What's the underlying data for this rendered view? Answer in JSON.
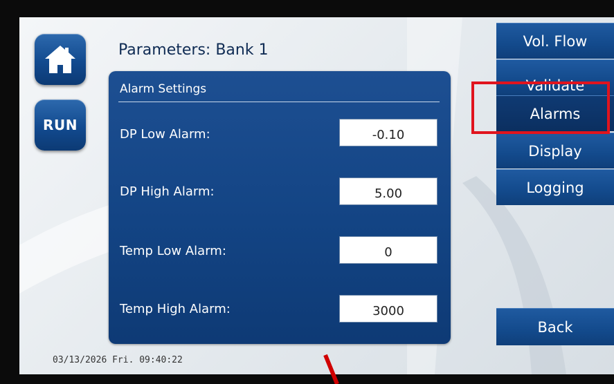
{
  "header": {
    "title": "Parameters: Bank 1"
  },
  "side_buttons": {
    "run_label": "RUN"
  },
  "panel": {
    "title": "Alarm Settings",
    "rows": [
      {
        "label": "DP Low Alarm:",
        "value": "-0.10"
      },
      {
        "label": "DP High Alarm:",
        "value": "5.00"
      },
      {
        "label": "Temp Low Alarm:",
        "value": "0"
      },
      {
        "label": "Temp High Alarm:",
        "value": "3000"
      }
    ]
  },
  "nav": {
    "vol_flow": "Vol. Flow",
    "validate": "Validate",
    "alarms": "Alarms",
    "display": "Display",
    "logging": "Logging",
    "back": "Back"
  },
  "status": {
    "datetime": "03/13/2026  Fri. 09:40:22"
  },
  "colors": {
    "accent_blue": "#134484",
    "highlight_box": "#e0141e",
    "annotation_line": "#d00000"
  }
}
